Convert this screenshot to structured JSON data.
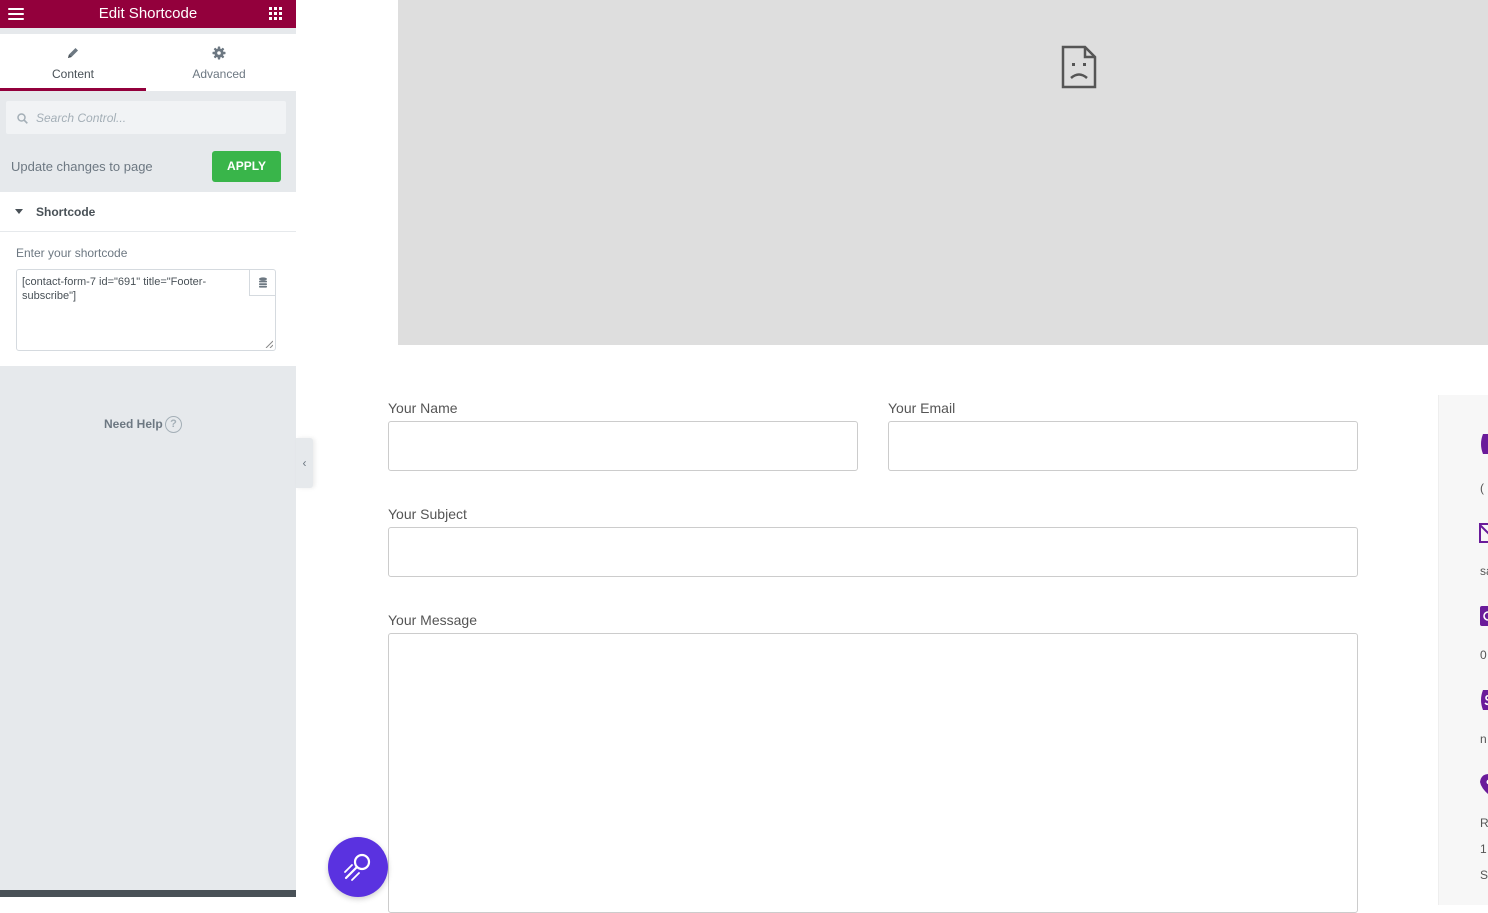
{
  "panel": {
    "title": "Edit Shortcode",
    "tabs": [
      {
        "label": "Content",
        "icon": "pencil-icon",
        "active": true
      },
      {
        "label": "Advanced",
        "icon": "gear-icon",
        "active": false
      }
    ],
    "search_placeholder": "Search Control...",
    "update_label": "Update changes to page",
    "apply_label": "APPLY",
    "section_title": "Shortcode",
    "shortcode_label": "Enter your shortcode",
    "shortcode_value": "[contact-form-7 id=\"691\" title=\"Footer-subscribe\"]",
    "help_label": "Need Help",
    "help_icon_glyph": "?",
    "collapse_glyph": "‹",
    "colors": {
      "header": "#93003c",
      "apply": "#39b54a",
      "panel_bg": "#e6e9ec"
    }
  },
  "form": {
    "name_label": "Your Name",
    "email_label": "Your Email",
    "subject_label": "Your Subject",
    "message_label": "Your Message"
  },
  "contact_card": {
    "snippets": [
      "(",
      "sa",
      "0",
      "n",
      "R",
      "1",
      "S"
    ],
    "icon_color": "#6a1b9a"
  },
  "fab": {
    "icon": "magnifier-icon",
    "color": "#5a32e0"
  }
}
